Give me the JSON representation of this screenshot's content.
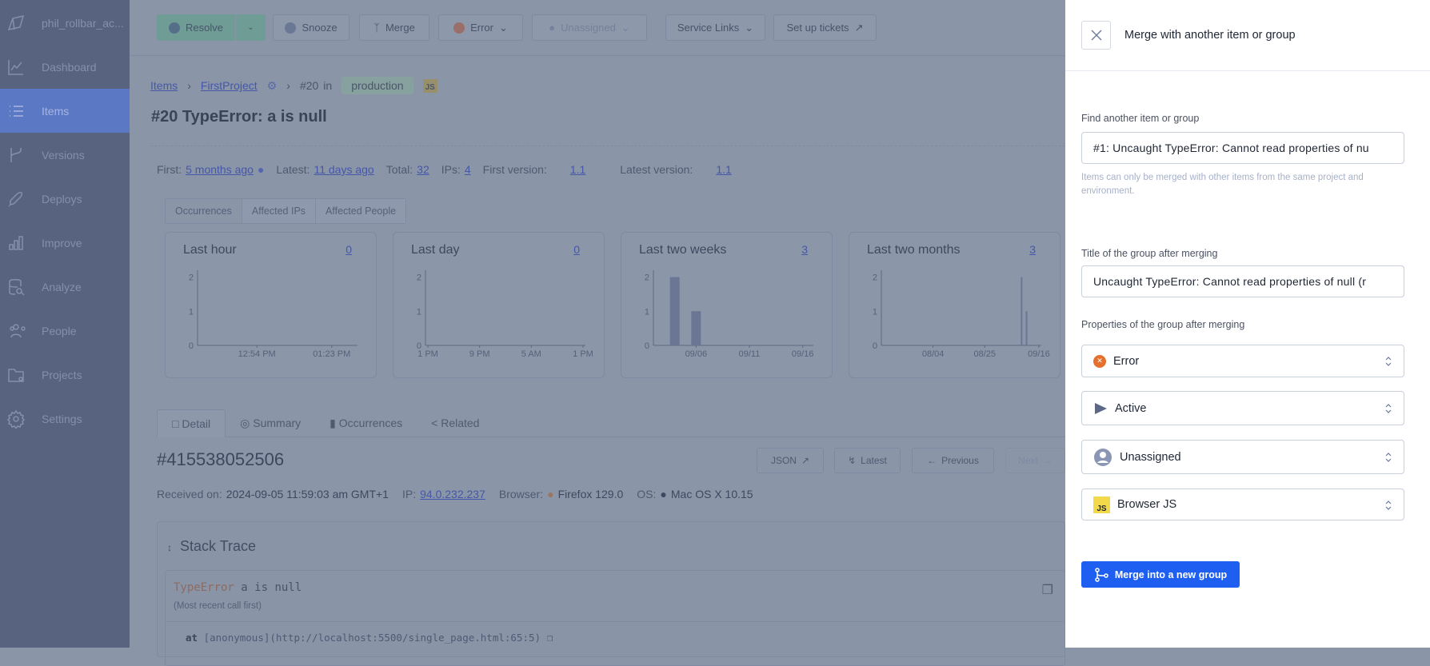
{
  "sidebar": {
    "account": "phil_rollbar_ac...",
    "items": [
      {
        "label": "Dashboard",
        "icon": "chart-line-icon"
      },
      {
        "label": "Items",
        "icon": "list-icon",
        "active": true
      },
      {
        "label": "Versions",
        "icon": "branch-icon"
      },
      {
        "label": "Deploys",
        "icon": "rocket-icon"
      },
      {
        "label": "Improve",
        "icon": "bar-chart-icon"
      },
      {
        "label": "Analyze",
        "icon": "database-search-icon"
      },
      {
        "label": "People",
        "icon": "people-icon"
      },
      {
        "label": "Projects",
        "icon": "folder-gear-icon"
      },
      {
        "label": "Settings",
        "icon": "gear-icon"
      }
    ]
  },
  "toolbar": {
    "resolve": "Resolve",
    "snooze": "Snooze",
    "merge": "Merge",
    "level": "Error",
    "assignee": "Unassigned",
    "service_links": "Service Links",
    "tickets": "Set up tickets"
  },
  "breadcrumb": {
    "items": "Items",
    "project": "FirstProject",
    "item": "#20",
    "in": "in",
    "env": "production",
    "lang": "JS"
  },
  "item_title": "#20 TypeError: a is null",
  "stats": {
    "first_label": "First:",
    "first": "5 months ago",
    "latest_label": "Latest:",
    "latest": "11 days ago",
    "total_label": "Total:",
    "total": "32",
    "ips_label": "IPs:",
    "ips": "4",
    "first_version_label": "First version:",
    "first_version": "1.1",
    "latest_version_label": "Latest version:",
    "latest_version": "1.1"
  },
  "graph_tabs": [
    "Occurrences",
    "Affected IPs",
    "Affected People"
  ],
  "chart_data": [
    {
      "type": "bar",
      "title": "Last hour",
      "count": "0",
      "ylim": [
        0,
        2.2
      ],
      "yticks": [
        0,
        1,
        2
      ],
      "xticks": [
        "12:54 PM",
        "01:23 PM"
      ],
      "xlim": [
        "12:31 PM",
        "01:33 PM"
      ],
      "axis": "time",
      "bars": []
    },
    {
      "type": "bar",
      "title": "Last day",
      "count": "0",
      "ylim": [
        0,
        2.2
      ],
      "yticks": [
        0,
        1,
        2
      ],
      "xticks": [
        "1 PM",
        "9 PM",
        "5 AM",
        "1 PM"
      ],
      "axis": "even",
      "bars": []
    },
    {
      "type": "bar",
      "title": "Last two weeks",
      "count": "3",
      "ylim": [
        0,
        2.2
      ],
      "yticks": [
        0,
        1,
        2
      ],
      "xticks": [
        "09/06",
        "09/11",
        "09/16"
      ],
      "xlim": [
        "09/02",
        "09/17"
      ],
      "axis": "date",
      "bars": [
        {
          "x": "09/04",
          "y": 2
        },
        {
          "x": "09/06",
          "y": 1
        }
      ]
    },
    {
      "type": "bar",
      "title": "Last two months",
      "count": "3",
      "ylim": [
        0,
        2.2
      ],
      "yticks": [
        0,
        1,
        2
      ],
      "xticks": [
        "08/04",
        "08/25",
        "09/16"
      ],
      "xlim": [
        "07/14",
        "09/17"
      ],
      "axis": "date",
      "bars": [
        {
          "x": "09/09",
          "y": 2
        },
        {
          "x": "09/11",
          "y": 1
        }
      ]
    }
  ],
  "detail_tabs": [
    "Detail",
    "Summary",
    "Occurrences",
    "Related"
  ],
  "occurrence": {
    "id": "#415538052506",
    "json": "JSON",
    "latest": "Latest",
    "previous": "Previous",
    "next": "Next",
    "received_label": "Received on:",
    "received": "2024-09-05 11:59:03 am GMT+1",
    "ip_label": "IP:",
    "ip": "94.0.232.237",
    "browser_label": "Browser:",
    "browser": "Firefox 129.0",
    "os_label": "OS:",
    "os": "Mac OS X 10.15"
  },
  "stack": {
    "title": "Stack Trace",
    "error_type": "TypeError",
    "error_msg": "a is null",
    "note": "(Most recent call first)",
    "frame_at": "at",
    "frame": "[anonymous](http://localhost:5500/single_page.html:65:5)"
  },
  "panel": {
    "title": "Merge with another item or group",
    "find_label": "Find another item or group",
    "find_value": "#1: Uncaught TypeError: Cannot read properties of nu",
    "help": "Items can only be merged with other items from the same project and environment.",
    "title_label": "Title of the group after merging",
    "title_value": "Uncaught TypeError: Cannot read properties of null (r",
    "props_label": "Properties of the group after merging",
    "level": "Error",
    "status": "Active",
    "assignee": "Unassigned",
    "framework": "Browser JS",
    "framework_badge": "JS",
    "submit": "Merge into a new group",
    "accent": "#1e5ef0"
  }
}
